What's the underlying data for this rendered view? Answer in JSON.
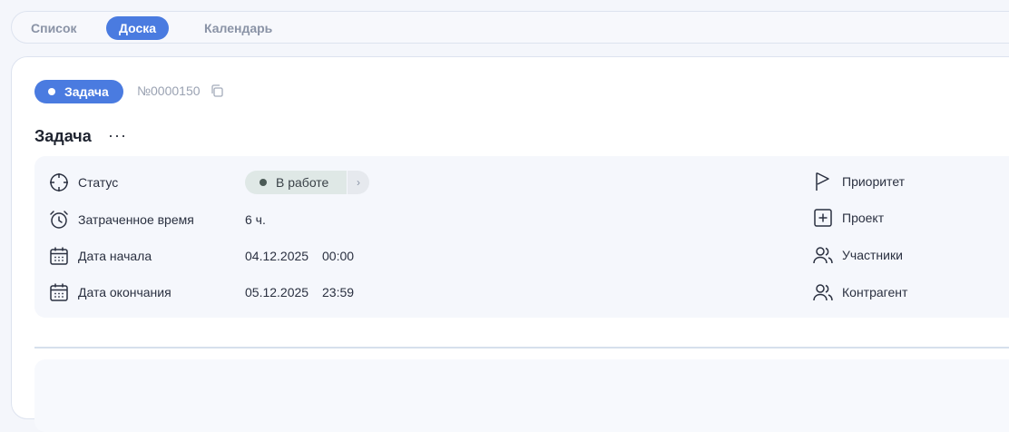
{
  "view_tabs": [
    {
      "label": "Список",
      "active": false
    },
    {
      "label": "Доска",
      "active": true
    },
    {
      "label": "Календарь",
      "active": false
    }
  ],
  "task": {
    "type_label": "Задача",
    "number": "№0000150",
    "title": "Задача",
    "more_label": "···"
  },
  "properties_left": {
    "status": {
      "label": "Статус",
      "value": "В работе",
      "icon": "target-icon"
    },
    "time_spent": {
      "label": "Затраченное время",
      "value": "6 ч.",
      "icon": "alarm-clock-icon"
    },
    "start_date": {
      "label": "Дата начала",
      "date": "04.12.2025",
      "time": "00:00",
      "icon": "calendar-icon"
    },
    "end_date": {
      "label": "Дата окончания",
      "date": "05.12.2025",
      "time": "23:59",
      "icon": "calendar-icon"
    }
  },
  "properties_right": {
    "priority": {
      "label": "Приоритет",
      "icon": "flag-icon"
    },
    "project": {
      "label": "Проект",
      "icon": "plus-square-icon"
    },
    "participants": {
      "label": "Участники",
      "icon": "users-icon"
    },
    "counterparty": {
      "label": "Контрагент",
      "icon": "users-icon"
    }
  },
  "colors": {
    "accent": "#4a7be0",
    "status_bg": "#dfe8e6"
  }
}
